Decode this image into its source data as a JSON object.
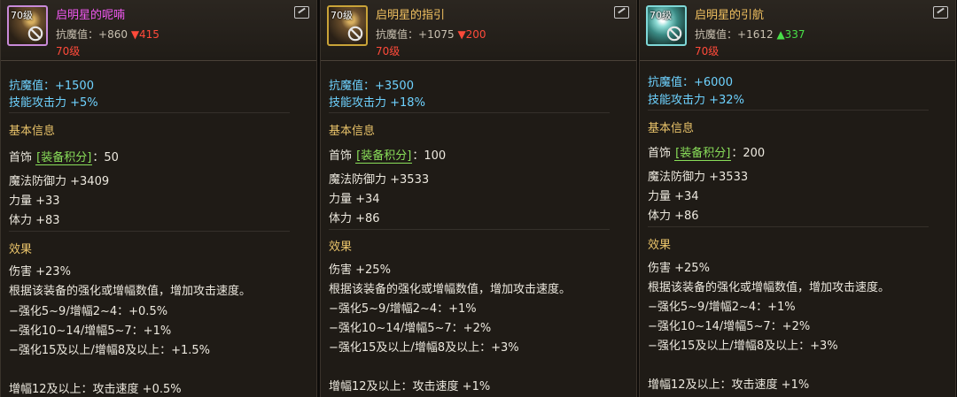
{
  "panels": [
    {
      "level_badge": "70级",
      "name": "启明星的呢喃",
      "compare_label": "抗魔值：",
      "compare_value": "+860",
      "delta": "▼415",
      "req_level": "70级",
      "anti_magic": "抗魔值：+1500",
      "skill_atk": "技能攻击力 +5%",
      "basic_title": "基本信息",
      "slot": "首饰",
      "score_label": "[装备积分]",
      "score_value": "：50",
      "mdef": "魔法防御力 +3409",
      "str": "力量 +33",
      "vit": "体力 +83",
      "effect_title": "效果",
      "dmg": "伤害 +23%",
      "desc": "根据该装备的强化或增幅数值，增加攻击速度。",
      "t1": "−强化5~9/增幅2~4：+0.5%",
      "t2": "−强化10~14/增幅5~7：+1%",
      "t3": "−强化15及以上/增幅8及以上：+1.5%",
      "amp12": "增幅12及以上：攻击速度 +0.5%"
    },
    {
      "level_badge": "70级",
      "name": "启明星的指引",
      "compare_label": "抗魔值：",
      "compare_value": "+1075",
      "delta": "▼200",
      "req_level": "70级",
      "anti_magic": "抗魔值：+3500",
      "skill_atk": "技能攻击力 +18%",
      "basic_title": "基本信息",
      "slot": "首饰",
      "score_label": "[装备积分]",
      "score_value": "：100",
      "mdef": "魔法防御力 +3533",
      "str": "力量 +34",
      "vit": "体力 +86",
      "effect_title": "效果",
      "dmg": "伤害 +25%",
      "desc": "根据该装备的强化或增幅数值，增加攻击速度。",
      "t1": "−强化5~9/增幅2~4：+1%",
      "t2": "−强化10~14/增幅5~7：+2%",
      "t3": "−强化15及以上/增幅8及以上：+3%",
      "amp12": "增幅12及以上：攻击速度 +1%"
    },
    {
      "level_badge": "70级",
      "name": "启明星的引航",
      "compare_label": "抗魔值：",
      "compare_value": "+1612",
      "delta": "▲337",
      "req_level": "70级",
      "anti_magic": "抗魔值：+6000",
      "skill_atk": "技能攻击力 +32%",
      "basic_title": "基本信息",
      "slot": "首饰",
      "score_label": "[装备积分]",
      "score_value": "：200",
      "mdef": "魔法防御力 +3533",
      "str": "力量 +34",
      "vit": "体力 +86",
      "effect_title": "效果",
      "dmg": "伤害 +25%",
      "desc": "根据该装备的强化或增幅数值，增加攻击速度。",
      "t1": "−强化5~9/增幅2~4：+1%",
      "t2": "−强化10~14/增幅5~7：+2%",
      "t3": "−强化15及以上/增幅8及以上：+3%",
      "amp12": "增幅12及以上：攻击速度 +1%"
    }
  ],
  "icons": {
    "forbidden": "forbidden-icon",
    "share": "share-icon"
  },
  "colors": {
    "legendary_name": "#f058f0",
    "epic_name": "#f0c060",
    "stat_blue": "#6ed2ff",
    "section_gold": "#e9c36a",
    "delta_down": "#ff4a3a",
    "delta_up": "#48e048",
    "score_tag": "#8adf5a"
  }
}
